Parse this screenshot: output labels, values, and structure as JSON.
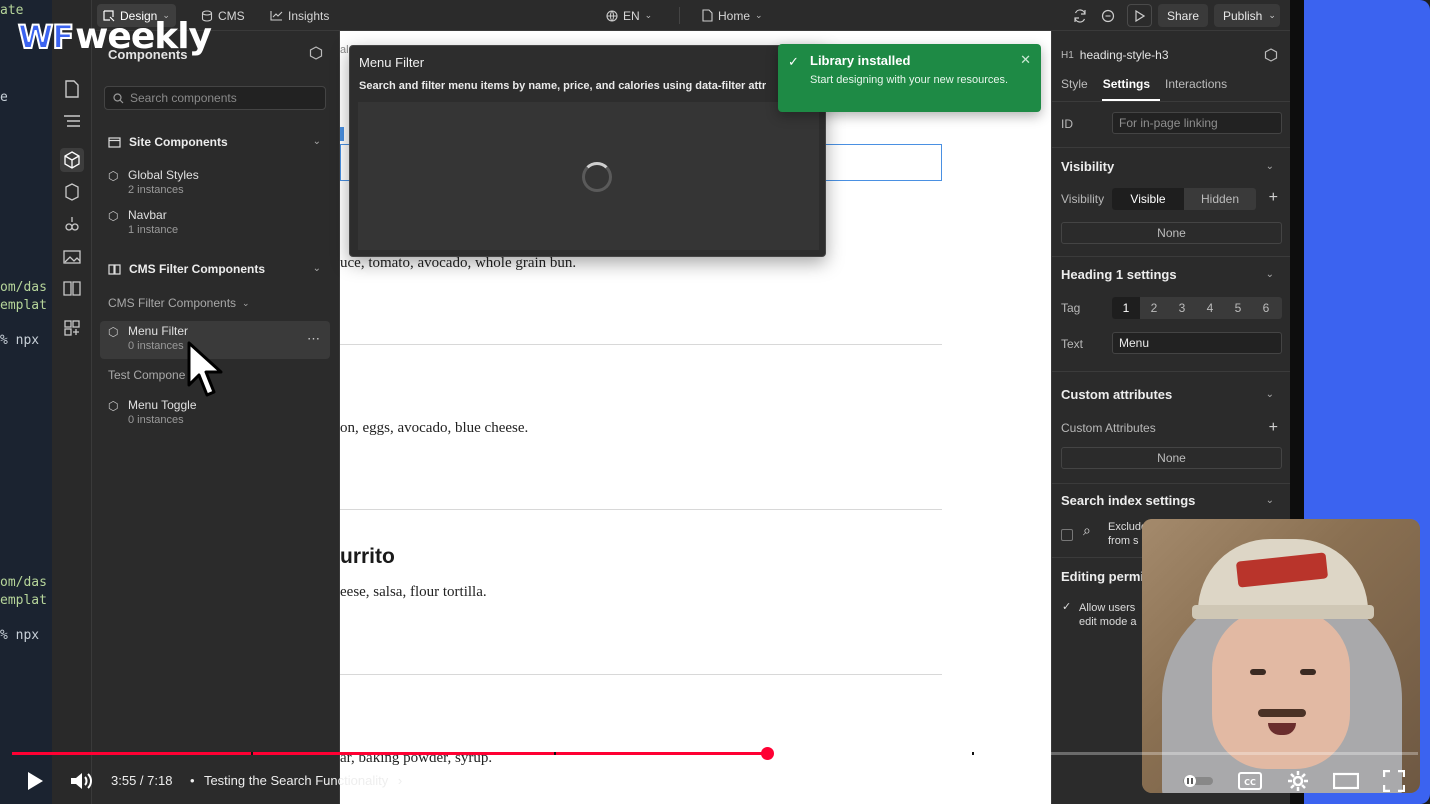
{
  "logo": {
    "wf": "WF",
    "weekly": "weekly"
  },
  "terminal": {
    "lines": [
      "ate",
      "e",
      "om/das",
      "emplat",
      "% npx",
      "om/das",
      "emplat",
      "% npx"
    ]
  },
  "topbar": {
    "design": "Design",
    "cms": "CMS",
    "insights": "Insights",
    "locale": "EN",
    "page": "Home",
    "share": "Share",
    "publish": "Publish"
  },
  "components": {
    "title": "Components",
    "search_placeholder": "Search components",
    "site_section": "Site Components",
    "site_items": [
      {
        "name": "Global Styles",
        "sub": "2 instances"
      },
      {
        "name": "Navbar",
        "sub": "1 instance"
      }
    ],
    "cms_section": "CMS Filter Components",
    "cms_sub": "CMS Filter Components",
    "cms_items": [
      {
        "name": "Menu Filter",
        "sub": "0 instances"
      }
    ],
    "test_sub": "Test Compone",
    "test_items": [
      {
        "name": "Menu Toggle",
        "sub": "0 instances"
      }
    ]
  },
  "canvas": {
    "crumb": "al",
    "line1": "uce, tomato, avocado, whole grain bun.",
    "line2": "on, eggs, avocado, blue cheese.",
    "heading3": "urrito",
    "line3": "eese, salsa, flour tortilla.",
    "line4": "ar, baking powder, syrup."
  },
  "preview": {
    "title": "Menu Filter",
    "description": "Search and filter menu items by name, price, and calories using data-filter attr"
  },
  "toast": {
    "title": "Library installed",
    "body": "Start designing with your new resources."
  },
  "settings": {
    "element_tag": "H1",
    "element_name": "heading-style-h3",
    "tabs": [
      "Style",
      "Settings",
      "Interactions"
    ],
    "id_label": "ID",
    "id_placeholder": "For in-page linking",
    "visibility_section": "Visibility",
    "visibility_label": "Visibility",
    "visible": "Visible",
    "hidden": "Hidden",
    "none1": "None",
    "heading_section": "Heading 1 settings",
    "tag_label": "Tag",
    "tags": [
      "1",
      "2",
      "3",
      "4",
      "5",
      "6"
    ],
    "text_label": "Text",
    "text_value": "Menu",
    "custom_attr_section": "Custom attributes",
    "custom_attr_label": "Custom Attributes",
    "none2": "None",
    "search_index_section": "Search index settings",
    "exclude_line1": "Exclude",
    "exclude_line2": "from s",
    "editing_section": "Editing permi",
    "allow_line1": "Allow users",
    "allow_line2": "edit mode a"
  },
  "player": {
    "time": "3:55 / 7:18",
    "chapter": "Testing the Search Functionality",
    "progress_fraction": 0.537,
    "buffer_fraction": 0.579,
    "accent": "#ff0033"
  }
}
